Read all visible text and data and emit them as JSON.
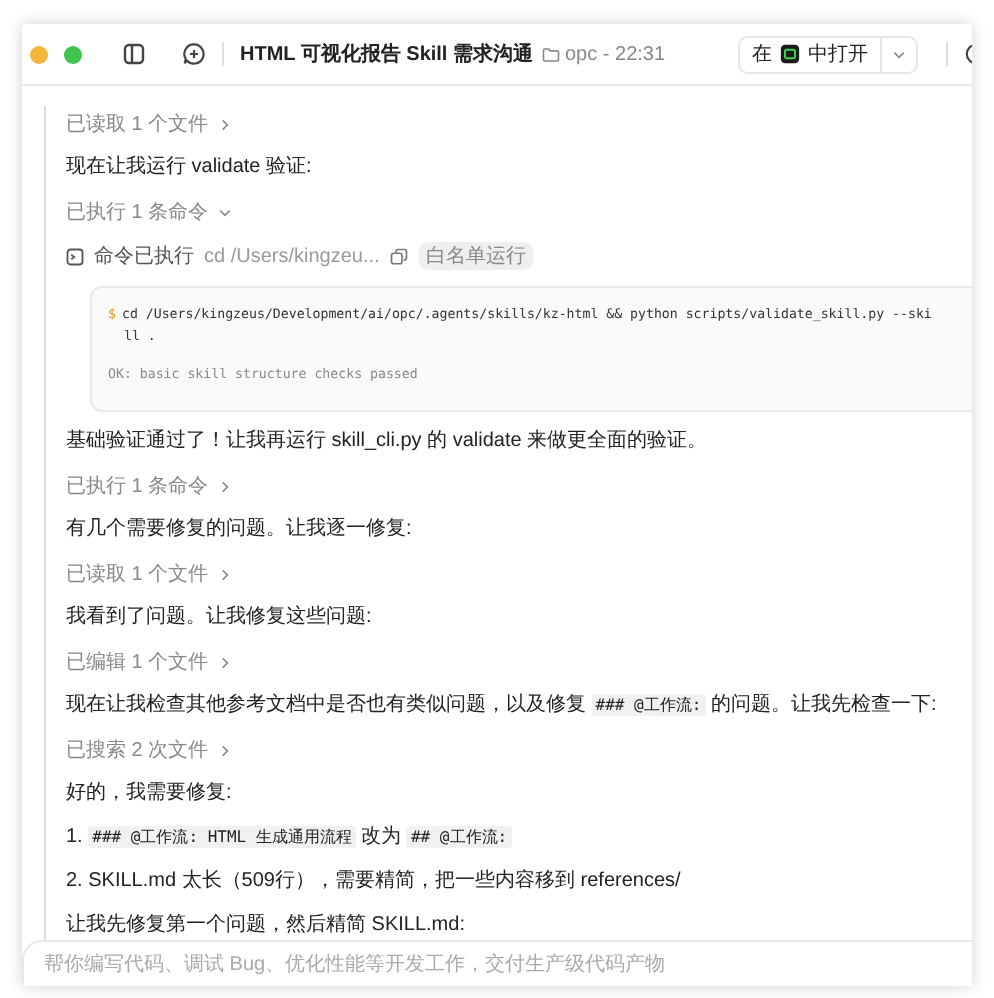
{
  "window": {
    "title": "HTML 可视化报告 Skill 需求沟通",
    "project": "opc - 22:31",
    "open_button": {
      "prefix": "在",
      "suffix": "中打开"
    }
  },
  "messages": [
    {
      "kind": "activity",
      "label": "已读取 1 个文件",
      "expanded": false
    },
    {
      "kind": "text",
      "parts": [
        {
          "kind": "plain",
          "text": "现在让我运行 validate 验证:"
        }
      ]
    },
    {
      "kind": "activity",
      "label": "已执行 1 条命令",
      "expanded": true
    },
    {
      "kind": "command",
      "status": "命令已执行",
      "summary": "cd /Users/kingzeu...",
      "badge": "白名单运行",
      "prompt": "$",
      "lines": [
        "cd /Users/kingzeus/Development/ai/opc/.agents/skills/kz-html && python scripts/validate_skill.py --ski",
        "ll ."
      ],
      "output": "OK: basic skill structure checks passed"
    },
    {
      "kind": "text",
      "parts": [
        {
          "kind": "plain",
          "text": "基础验证通过了！让我再运行 skill_cli.py 的 validate 来做更全面的验证。"
        }
      ]
    },
    {
      "kind": "activity",
      "label": "已执行 1 条命令",
      "expanded": false
    },
    {
      "kind": "text",
      "parts": [
        {
          "kind": "plain",
          "text": "有几个需要修复的问题。让我逐一修复:"
        }
      ]
    },
    {
      "kind": "activity",
      "label": "已读取 1 个文件",
      "expanded": false
    },
    {
      "kind": "text",
      "parts": [
        {
          "kind": "plain",
          "text": "我看到了问题。让我修复这些问题:"
        }
      ]
    },
    {
      "kind": "activity",
      "label": "已编辑 1 个文件",
      "expanded": false
    },
    {
      "kind": "text",
      "parts": [
        {
          "kind": "plain",
          "text": "现在让我检查其他参考文档中是否也有类似问题，以及修复 "
        },
        {
          "kind": "code",
          "text": "### @工作流:"
        },
        {
          "kind": "plain",
          "text": " 的问题。让我先检查一下:"
        }
      ]
    },
    {
      "kind": "activity",
      "label": "已搜索 2 次文件",
      "expanded": false
    },
    {
      "kind": "text",
      "parts": [
        {
          "kind": "plain",
          "text": "好的，我需要修复:"
        }
      ]
    },
    {
      "kind": "text",
      "parts": [
        {
          "kind": "plain",
          "text": "1. "
        },
        {
          "kind": "code",
          "text": "### @工作流: HTML 生成通用流程"
        },
        {
          "kind": "plain",
          "text": " 改为 "
        },
        {
          "kind": "code",
          "text": "## @工作流:"
        }
      ]
    },
    {
      "kind": "text",
      "parts": [
        {
          "kind": "plain",
          "text": "2. SKILL.md 太长（509行），需要精简，把一些内容移到 references/"
        }
      ]
    },
    {
      "kind": "text",
      "parts": [
        {
          "kind": "plain",
          "text": "让我先修复第一个问题，然后精简 SKILL.md:"
        }
      ]
    }
  ],
  "composer": {
    "placeholder": "帮你编写代码、调试 Bug、优化性能等开发工作，交付生产级代码产物"
  }
}
